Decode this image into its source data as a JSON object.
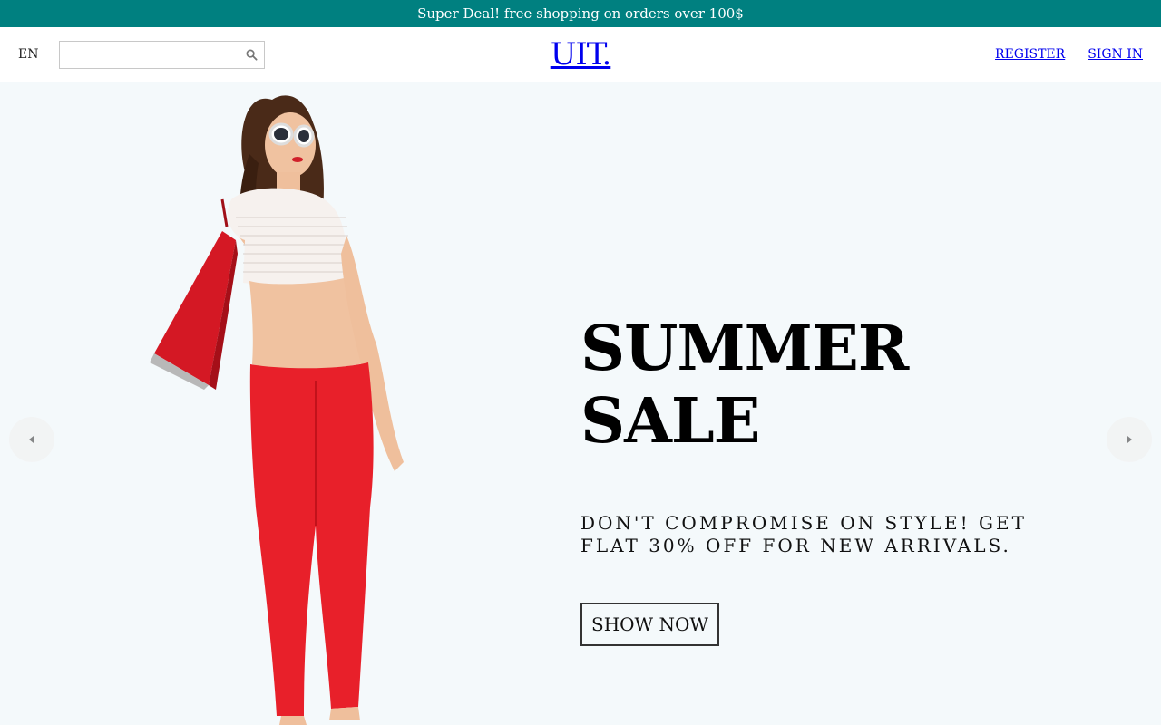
{
  "announcement": {
    "text": "Super Deal! free shopping on orders over 100$",
    "bg_color": "#008080"
  },
  "navbar": {
    "language": "EN",
    "search": {
      "value": "",
      "placeholder": "",
      "icon": "search-icon"
    },
    "logo": "UIT.",
    "links": {
      "register": "REGISTER",
      "sign_in": "SIGN IN"
    }
  },
  "slider": {
    "bg_color": "#f4f9fb",
    "title": "SUMMER SALE",
    "description": "DON'T COMPROMISE ON STYLE! GET FLAT 30% OFF FOR NEW ARRIVALS.",
    "button_label": "SHOW NOW",
    "left_arrow_icon": "arrow-left-icon",
    "right_arrow_icon": "arrow-right-icon",
    "image_subject": "model-with-shopping-bag"
  }
}
